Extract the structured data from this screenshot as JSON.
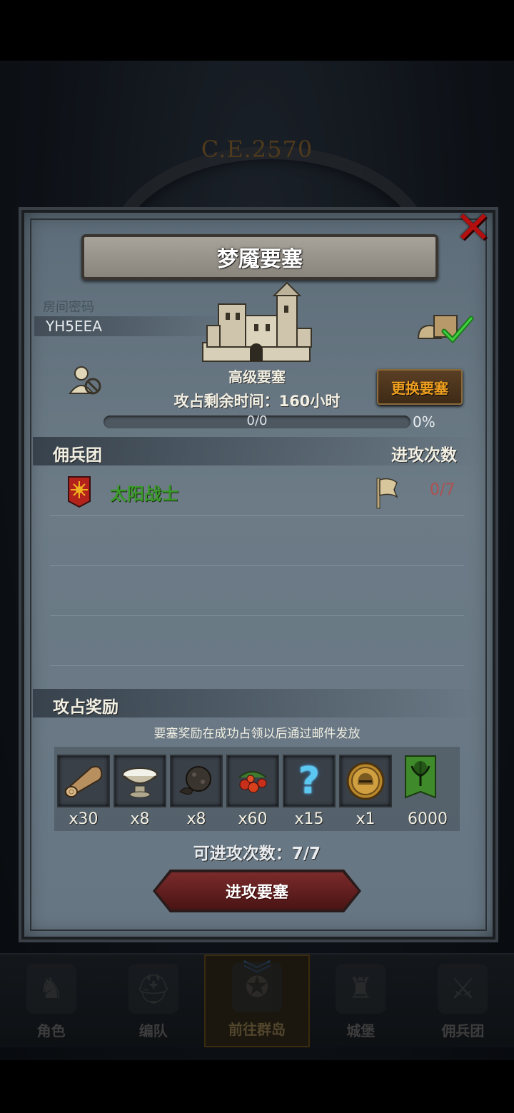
{
  "background": {
    "era_text": "C.E.2570"
  },
  "bottom_nav": [
    {
      "label": "角色",
      "icon": "knight-icon",
      "active": false
    },
    {
      "label": "编队",
      "icon": "helmet-icon",
      "active": false
    },
    {
      "label": "前往群岛",
      "icon": "compass-icon",
      "active": true
    },
    {
      "label": "城堡",
      "icon": "castle-icon",
      "active": false
    },
    {
      "label": "佣兵团",
      "icon": "mercenary-icon",
      "active": false
    }
  ],
  "dialog": {
    "title": "梦魇要塞",
    "room_password_label": "房间密码",
    "room_password": "YH5EEA",
    "fortress_level": "高级要塞",
    "remaining_time": "攻占剩余时间：160小时",
    "change_fortress_label": "更换要塞",
    "progress": {
      "text": "0/0",
      "percent_text": "0%",
      "fraction": 0
    },
    "mercenary_section": {
      "title": "佣兵团",
      "attack_count_header": "进攻次数",
      "rows": [
        {
          "name": "太阳战士",
          "count": "0/7",
          "banner_color": "#b3231b"
        }
      ]
    },
    "reward_section": {
      "title": "攻占奖励",
      "note": "要塞奖励在成功占领以后通过邮件发放",
      "items": [
        {
          "icon": "wood-log-icon",
          "qty": "x30"
        },
        {
          "icon": "milk-bowl-icon",
          "qty": "x8"
        },
        {
          "icon": "truffle-icon",
          "qty": "x8"
        },
        {
          "icon": "berries-icon",
          "qty": "x60"
        },
        {
          "icon": "mystery-question-icon",
          "qty": "x15"
        },
        {
          "icon": "helmet-coin-icon",
          "qty": "x1"
        },
        {
          "icon": "guild-banner-icon",
          "qty": "6000"
        }
      ]
    },
    "attempts": "可进攻次数：7/7",
    "attack_button": "进攻要塞"
  },
  "colors": {
    "merc_name": "#3a9a2a",
    "change_button_text": "#f0a020",
    "close": "#b40f0f"
  }
}
